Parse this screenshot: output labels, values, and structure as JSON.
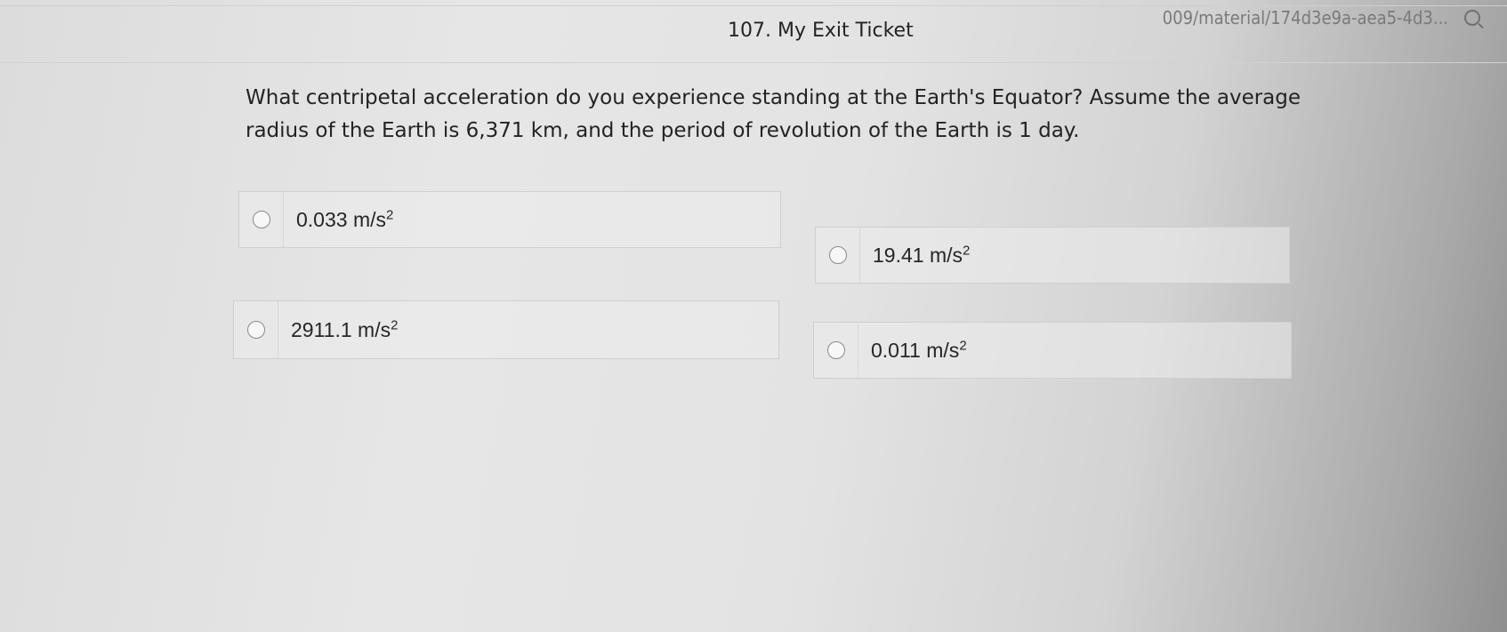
{
  "browser": {
    "url_text": "009/material/174d3e9a-aea5-4d3...",
    "search_icon": "search-icon"
  },
  "ticket": {
    "title": "107. My Exit Ticket",
    "question": "What centripetal acceleration do you experience standing at the Earth's Equator? Assume the average radius of the Earth is 6,371 km, and the period of revolution of the Earth is 1 day."
  },
  "options": [
    {
      "value": "0.033",
      "unit": "m/s",
      "exponent": "2"
    },
    {
      "value": "19.41",
      "unit": "m/s",
      "exponent": "2"
    },
    {
      "value": "2911.1",
      "unit": "m/s",
      "exponent": "2"
    },
    {
      "value": "0.011",
      "unit": "m/s",
      "exponent": "2"
    }
  ]
}
